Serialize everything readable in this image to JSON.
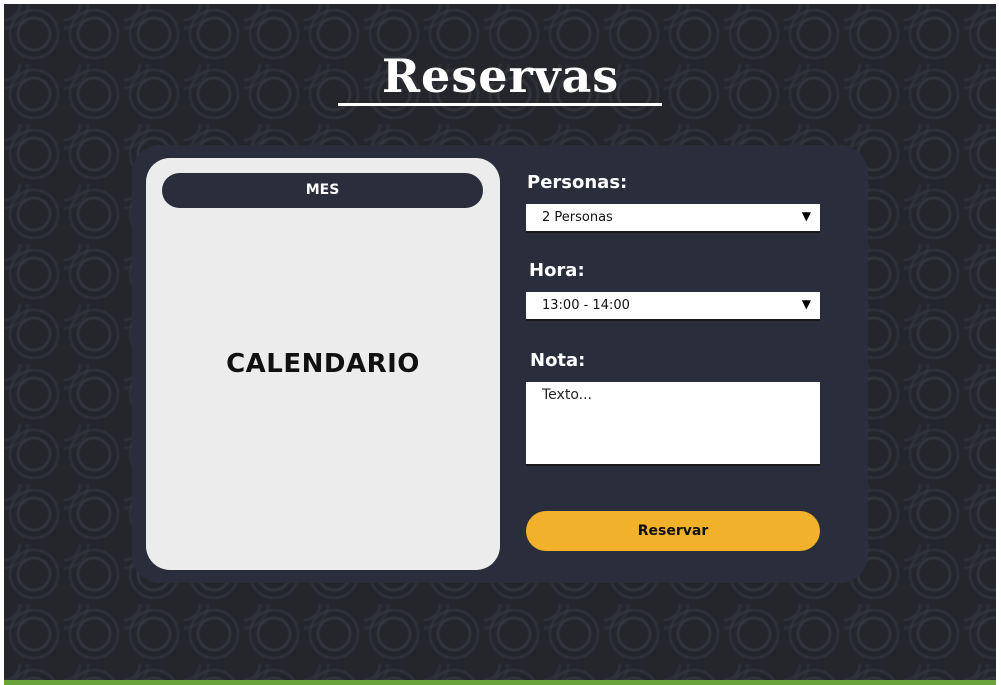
{
  "page": {
    "title": "Reservas"
  },
  "calendar": {
    "month_label": "MES",
    "placeholder": "CALENDARIO"
  },
  "form": {
    "personas": {
      "label": "Personas:",
      "value": "2 Personas"
    },
    "hora": {
      "label": "Hora:",
      "value": "13:00 - 14:00"
    },
    "nota": {
      "label": "Nota:",
      "placeholder": "Texto..."
    },
    "submit_label": "Reservar"
  },
  "icons": {
    "dropdown": "chevron-down-icon"
  },
  "colors": {
    "background": "#24262c",
    "panel": "#2a2d3c",
    "calendar_card": "#ececec",
    "accent_button": "#f2b12b",
    "bottom_strip": "#6aa33a"
  }
}
